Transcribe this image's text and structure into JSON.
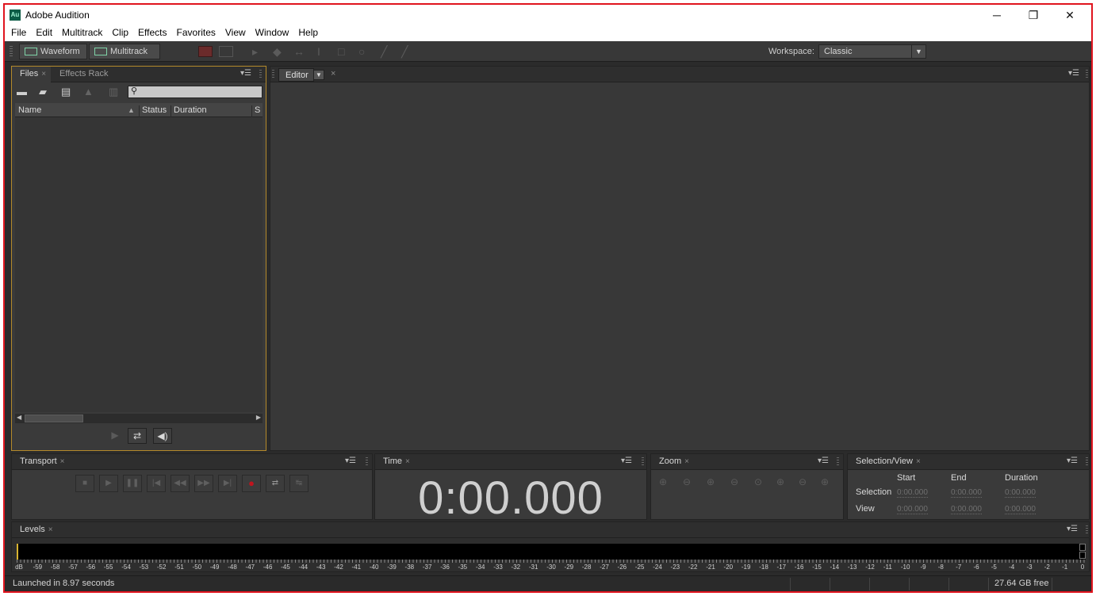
{
  "window": {
    "title": "Adobe Audition",
    "icon_text": "Au",
    "minimize": "─",
    "restore": "❐",
    "close": "✕"
  },
  "menu": [
    "File",
    "Edit",
    "Multitrack",
    "Clip",
    "Effects",
    "Favorites",
    "View",
    "Window",
    "Help"
  ],
  "toolbar": {
    "waveform_label": "Waveform",
    "multitrack_label": "Multitrack",
    "workspace_label": "Workspace:",
    "workspace_value": "Classic"
  },
  "files_panel": {
    "tabs": [
      "Files",
      "Effects Rack"
    ],
    "columns": [
      "Name",
      "Status",
      "Duration",
      "S"
    ]
  },
  "editor_panel": {
    "tab": "Editor"
  },
  "transport_panel": {
    "tab": "Transport"
  },
  "time_panel": {
    "tab": "Time",
    "value": "0:00.000"
  },
  "zoom_panel": {
    "tab": "Zoom"
  },
  "selection_panel": {
    "tab": "Selection/View",
    "headers": [
      "Start",
      "End",
      "Duration"
    ],
    "rows": [
      {
        "label": "Selection",
        "start": "0:00.000",
        "end": "0:00.000",
        "duration": "0:00.000"
      },
      {
        "label": "View",
        "start": "0:00.000",
        "end": "0:00.000",
        "duration": "0:00.000"
      }
    ]
  },
  "levels_panel": {
    "tab": "Levels",
    "scale": [
      "dB",
      "-59",
      "-58",
      "-57",
      "-56",
      "-55",
      "-54",
      "-53",
      "-52",
      "-51",
      "-50",
      "-49",
      "-48",
      "-47",
      "-46",
      "-45",
      "-44",
      "-43",
      "-42",
      "-41",
      "-40",
      "-39",
      "-38",
      "-37",
      "-36",
      "-35",
      "-34",
      "-33",
      "-32",
      "-31",
      "-30",
      "-29",
      "-28",
      "-27",
      "-26",
      "-25",
      "-24",
      "-23",
      "-22",
      "-21",
      "-20",
      "-19",
      "-18",
      "-17",
      "-16",
      "-15",
      "-14",
      "-13",
      "-12",
      "-11",
      "-10",
      "-9",
      "-8",
      "-7",
      "-6",
      "-5",
      "-4",
      "-3",
      "-2",
      "-1",
      "0"
    ]
  },
  "status": {
    "message": "Launched in 8.97 seconds",
    "free_space": "27.64 GB free"
  },
  "colors": {
    "accent_border": "#b48a2a",
    "record": "#c0141e",
    "frame_red": "#e0141e"
  }
}
